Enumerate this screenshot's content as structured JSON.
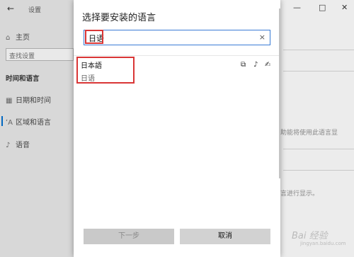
{
  "settings": {
    "back_glyph": "←",
    "title": "设置",
    "home": "主页",
    "search_placeholder": "查找设置",
    "section": "时间和语言",
    "items": [
      {
        "label": "日期和时间"
      },
      {
        "label": "区域和语言"
      },
      {
        "label": "语音"
      }
    ],
    "main_texts": [
      "助能将使用此语言显",
      "言进行显示。"
    ]
  },
  "window_controls": {
    "minimize": "—",
    "maximize": "□",
    "close": "✕"
  },
  "dialog": {
    "title": "选择要安装的语言",
    "search_value": "日语",
    "clear_glyph": "×",
    "result": {
      "native": "日本語",
      "name": "日语"
    },
    "next_label": "下一步",
    "cancel_label": "取消"
  },
  "watermark": {
    "text": "Bai 经验",
    "sub": "jingyan.baidu.com"
  },
  "colors": {
    "accent": "#0067c0",
    "highlight": "#d93636"
  }
}
